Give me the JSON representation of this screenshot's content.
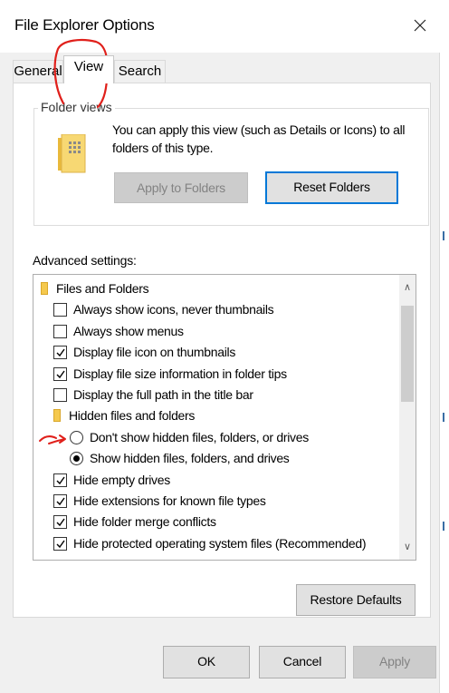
{
  "window": {
    "title": "File Explorer Options"
  },
  "tabs": [
    {
      "label": "General",
      "active": false
    },
    {
      "label": "View",
      "active": true
    },
    {
      "label": "Search",
      "active": false
    }
  ],
  "folder_views": {
    "group_label": "Folder views",
    "description": "You can apply this view (such as Details or Icons) to all folders of this type.",
    "apply_button": "Apply to Folders",
    "reset_button": "Reset Folders"
  },
  "advanced": {
    "label": "Advanced settings:",
    "items": [
      {
        "type": "folder",
        "label": "Files and Folders",
        "level": 0
      },
      {
        "type": "checkbox",
        "label": "Always show icons, never thumbnails",
        "checked": false,
        "level": 1
      },
      {
        "type": "checkbox",
        "label": "Always show menus",
        "checked": false,
        "level": 1
      },
      {
        "type": "checkbox",
        "label": "Display file icon on thumbnails",
        "checked": true,
        "level": 1
      },
      {
        "type": "checkbox",
        "label": "Display file size information in folder tips",
        "checked": true,
        "level": 1
      },
      {
        "type": "checkbox",
        "label": "Display the full path in the title bar",
        "checked": false,
        "level": 1
      },
      {
        "type": "folder",
        "label": "Hidden files and folders",
        "level": 1
      },
      {
        "type": "radio",
        "label": "Don't show hidden files, folders, or drives",
        "checked": false,
        "level": 2
      },
      {
        "type": "radio",
        "label": "Show hidden files, folders, and drives",
        "checked": true,
        "level": 2
      },
      {
        "type": "checkbox",
        "label": "Hide empty drives",
        "checked": true,
        "level": 1
      },
      {
        "type": "checkbox",
        "label": "Hide extensions for known file types",
        "checked": true,
        "level": 1
      },
      {
        "type": "checkbox",
        "label": "Hide folder merge conflicts",
        "checked": true,
        "level": 1
      },
      {
        "type": "checkbox",
        "label": "Hide protected operating system files (Recommended)",
        "checked": true,
        "level": 1
      }
    ]
  },
  "buttons": {
    "restore_defaults": "Restore Defaults",
    "ok": "OK",
    "cancel": "Cancel",
    "apply": "Apply"
  },
  "colors": {
    "accent": "#0078d7",
    "annotation": "#e0201b",
    "folder": "#f5c94e"
  },
  "icons": {
    "close": "close-icon",
    "folder_views": "folder-views-icon",
    "tree_folder": "folder-icon",
    "scroll_up": "chevron-up-icon",
    "scroll_down": "chevron-down-icon"
  }
}
